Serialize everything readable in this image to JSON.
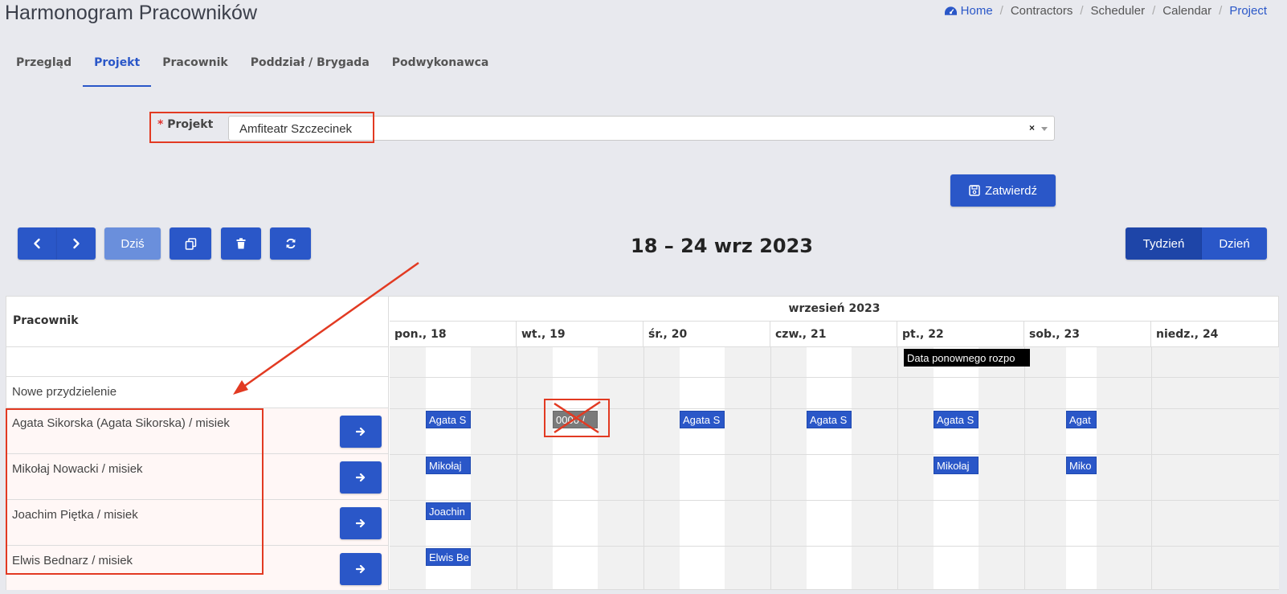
{
  "page": {
    "title": "Harmonogram Pracowników"
  },
  "breadcrumb": {
    "home": "Home",
    "contractors": "Contractors",
    "scheduler": "Scheduler",
    "calendar": "Calendar",
    "project": "Project"
  },
  "tabs": [
    {
      "label": "Przegląd"
    },
    {
      "label": "Projekt"
    },
    {
      "label": "Pracownik"
    },
    {
      "label": "Poddział / Brygada"
    },
    {
      "label": "Podwykonawca"
    }
  ],
  "project_field": {
    "required_mark": "*",
    "label": "Projekt",
    "value": "Amfiteatr Szczecinek",
    "clear": "×"
  },
  "toolbar": {
    "confirm_label": "Zatwierdź",
    "today_label": "Dziś",
    "range": "18 – 24 wrz 2023",
    "week_label": "Tydzień",
    "day_label": "Dzień"
  },
  "schedule": {
    "resource_header": "Pracownik",
    "month": "wrzesień 2023",
    "days": [
      "pon., 18",
      "wt., 19",
      "śr., 20",
      "czw., 21",
      "pt., 22",
      "sob., 23",
      "niedz., 24"
    ],
    "new_assignment": "Nowe przydzielenie",
    "workers": [
      "Agata Sikorska (Agata Sikorska) / misiek",
      "Mikołaj Nowacki / misiek",
      "Joachim Piętka / misiek",
      "Elwis Bednarz / misiek"
    ],
    "events": {
      "restart": "Data ponownego rozpo",
      "agata": "Agata S",
      "agata_short": "Agat",
      "gray": "0000 /",
      "mikolaj": "Mikołaj",
      "mikolaj_short": "Miko",
      "joachim": "Joachin",
      "elwis": "Elwis Be"
    }
  },
  "colors": {
    "accent": "#2a57c8",
    "annotation": "#e23a22",
    "background": "#e8e9ee"
  }
}
